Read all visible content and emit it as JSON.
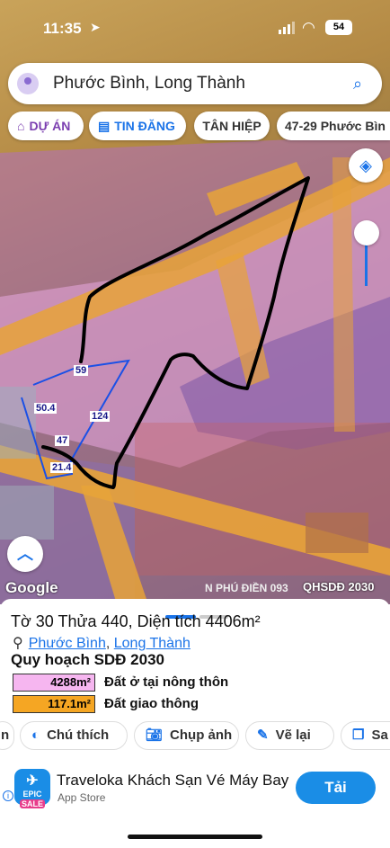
{
  "status": {
    "time": "11:35",
    "battery": "54"
  },
  "search": {
    "value": "Phước Bình, Long Thành"
  },
  "chips": [
    {
      "label": "DỰ ÁN"
    },
    {
      "label": "TIN ĐĂNG"
    },
    {
      "label": "TÂN HIỆP"
    },
    {
      "label": "47-29 Phước Bìn"
    }
  ],
  "map": {
    "dimensions": [
      "59",
      "50.4",
      "124",
      "47",
      "21.4"
    ],
    "google": "Google",
    "phu_dien": "N PHÚ ĐIỀN 093",
    "layer": "QHSDĐ 2030"
  },
  "sheet": {
    "title": "Tờ 30 Thửa 440, Diện tích 4406m²",
    "place_1": "Phước Bình",
    "place_sep": ", ",
    "place_2": "Long Thành",
    "plan_title": "Quy hoạch SDĐ 2030",
    "legend": [
      {
        "area": "4288m²",
        "label": "Đất ở tại nông thôn",
        "color": "#f6b6f0"
      },
      {
        "area": "117.1m²",
        "label": "Đất giao thông",
        "color": "#f5a623"
      }
    ]
  },
  "actions": [
    {
      "label": "n"
    },
    {
      "label": "Chú thích"
    },
    {
      "label": "Chụp ảnh"
    },
    {
      "label": "Vẽ lại"
    },
    {
      "label": "Sa"
    }
  ],
  "ad": {
    "app_name": "Traveloka Khách Sạn Vé Máy Bay",
    "store": "App Store",
    "cta": "Tải",
    "logo_top": "EPIC",
    "logo_bottom": "SALE"
  }
}
